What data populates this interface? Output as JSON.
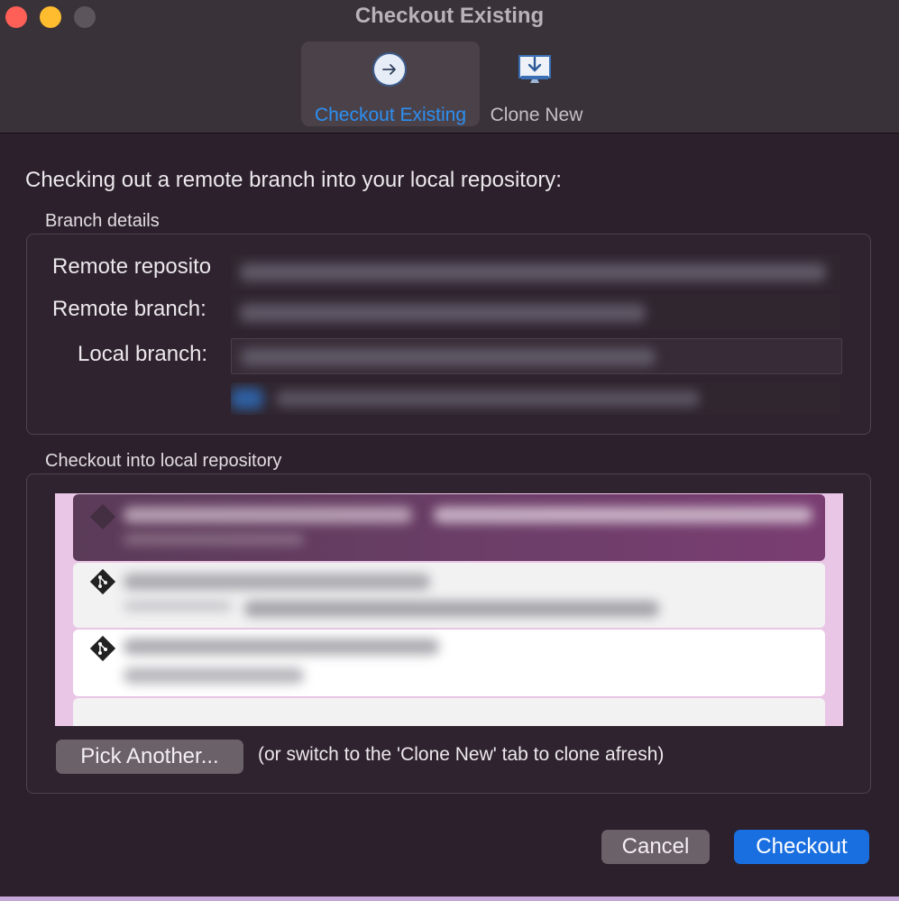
{
  "window": {
    "title": "Checkout Existing"
  },
  "tabs": [
    {
      "label": "Checkout Existing",
      "icon": "arrow-right-circle-icon",
      "selected": true
    },
    {
      "label": "Clone New",
      "icon": "download-tray-icon",
      "selected": false
    }
  ],
  "main": {
    "heading": "Checking out a remote branch into your local repository:"
  },
  "branch_details": {
    "section_label": "Branch details",
    "remote_repository_label": "Remote reposito",
    "remote_branch_label": "Remote branch:",
    "local_branch_label": "Local branch:"
  },
  "local_repository": {
    "section_label": "Checkout into local repository",
    "pick_button": "Pick Another...",
    "hint": "(or switch to the 'Clone New' tab to clone afresh)"
  },
  "footer": {
    "cancel_label": "Cancel",
    "checkout_label": "Checkout"
  },
  "colors": {
    "accent": "#1a6fe0",
    "tab_selected_text": "#2d8ff2",
    "list_background": "#e9c6e5",
    "selected_row": "#6d3e69"
  }
}
